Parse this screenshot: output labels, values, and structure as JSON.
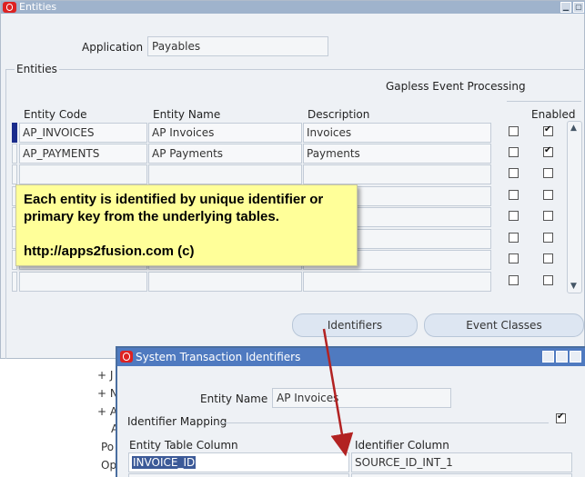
{
  "window": {
    "title": "Entities"
  },
  "application": {
    "label": "Application",
    "value": "Payables"
  },
  "entities_section": {
    "label": "Entities"
  },
  "gapless": {
    "label": "Gapless Event Processing"
  },
  "table": {
    "headers": {
      "code": "Entity Code",
      "name": "Entity Name",
      "description": "Description",
      "enabled": "Enabled"
    },
    "rows": [
      {
        "code": "AP_INVOICES",
        "name": "AP Invoices",
        "description": "Invoices",
        "gapless": false,
        "enabled": true
      },
      {
        "code": "AP_PAYMENTS",
        "name": "AP Payments",
        "description": "Payments",
        "gapless": false,
        "enabled": true
      },
      {
        "code": "",
        "name": "",
        "description": "",
        "gapless": false,
        "enabled": false
      },
      {
        "code": "",
        "name": "",
        "description": "",
        "gapless": false,
        "enabled": false
      },
      {
        "code": "",
        "name": "",
        "description": "",
        "gapless": false,
        "enabled": false
      },
      {
        "code": "",
        "name": "",
        "description": "",
        "gapless": false,
        "enabled": false
      },
      {
        "code": "",
        "name": "",
        "description": "",
        "gapless": false,
        "enabled": false
      },
      {
        "code": "",
        "name": "",
        "description": "",
        "gapless": false,
        "enabled": false
      }
    ]
  },
  "buttons": {
    "identifiers": "Identifiers",
    "event_classes": "Event Classes"
  },
  "note": {
    "line1": "Each entity is identified by unique identifier or primary key from the underlying tables.",
    "line2": "http://apps2fusion.com (c)"
  },
  "background_tree": {
    "items": [
      "+ J",
      "+ N",
      "+ A",
      "A",
      "Po",
      "Op"
    ]
  },
  "dialog": {
    "title": "System Transaction Identifiers",
    "entity_name_label": "Entity Name",
    "entity_name_value": "AP Invoices",
    "mapping_label": "Identifier Mapping",
    "mapping_checked": true,
    "col_table": "Entity Table Column",
    "col_identifier": "Identifier Column",
    "row_table_value": "INVOICE_ID",
    "row_identifier_value": "SOURCE_ID_INT_1"
  },
  "colors": {
    "titlebar": "#9fb3cc",
    "dialog_title": "#4f7ac0",
    "note_bg": "#ffff99",
    "arrow": "#b22222",
    "row_indicator": "#1a2c8c"
  }
}
